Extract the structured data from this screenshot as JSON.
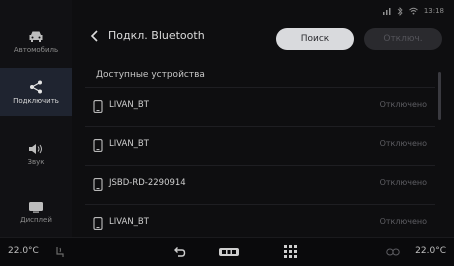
{
  "status_bar": {
    "time": "13:18"
  },
  "sidebar": {
    "items": [
      {
        "label": "Автомобиль",
        "icon": "car-icon",
        "active": false
      },
      {
        "label": "Подключить",
        "icon": "share-icon",
        "active": true
      },
      {
        "label": "Звук",
        "icon": "speaker-icon",
        "active": false
      },
      {
        "label": "Дисплей",
        "icon": "display-icon",
        "active": false
      }
    ]
  },
  "header": {
    "title": "Подкл. Bluetooth",
    "search_label": "Поиск",
    "disconnect_label": "Отключ."
  },
  "devices": {
    "section_title": "Доступные устройства",
    "items": [
      {
        "name": "LIVAN_BT",
        "status": "Отключено"
      },
      {
        "name": "LIVAN_BT",
        "status": "Отключено"
      },
      {
        "name": "JSBD-RD-2290914",
        "status": "Отключено"
      },
      {
        "name": "LIVAN_BT",
        "status": "Отключено"
      }
    ]
  },
  "bottom_bar": {
    "temp_left": "22.0°C",
    "temp_right": "22.0°C"
  },
  "colors": {
    "active_bg": "#1f2430",
    "search_button": "#d9dadd",
    "disabled_button": "#2a2a2e"
  }
}
